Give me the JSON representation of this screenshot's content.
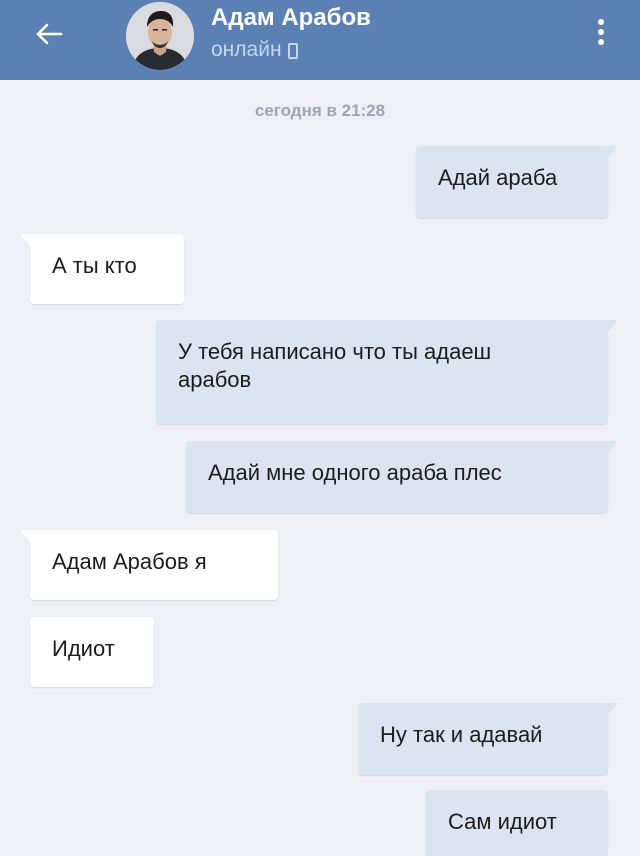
{
  "header": {
    "back_icon": "arrow-left-icon",
    "title": "Адам Арабов",
    "status": "онлайн",
    "status_icon": "phone-icon",
    "menu_icon": "more-vertical-icon",
    "colors": {
      "header_bg": "#5b80b4",
      "title": "#ffffff",
      "status": "#c6d6ee"
    }
  },
  "chat": {
    "date_separator": "сегодня в 21:28",
    "messages": [
      {
        "direction": "outgoing",
        "text": "Адай араба"
      },
      {
        "direction": "incoming",
        "text": "А ты кто"
      },
      {
        "direction": "outgoing",
        "text": "У тебя написано что ты адаеш\nарабов"
      },
      {
        "direction": "outgoing",
        "text": "Адай мне одного араба плес"
      },
      {
        "direction": "incoming",
        "text": "Адам Арабов  я"
      },
      {
        "direction": "incoming",
        "text": "Идиот"
      },
      {
        "direction": "outgoing",
        "text": "Ну так и адавай"
      },
      {
        "direction": "outgoing",
        "text": "Сам идиот"
      }
    ],
    "colors": {
      "background": "#eef0f5",
      "outgoing_bubble": "#dbe4f1",
      "incoming_bubble": "#ffffff",
      "date_text": "#9da5b4"
    }
  }
}
